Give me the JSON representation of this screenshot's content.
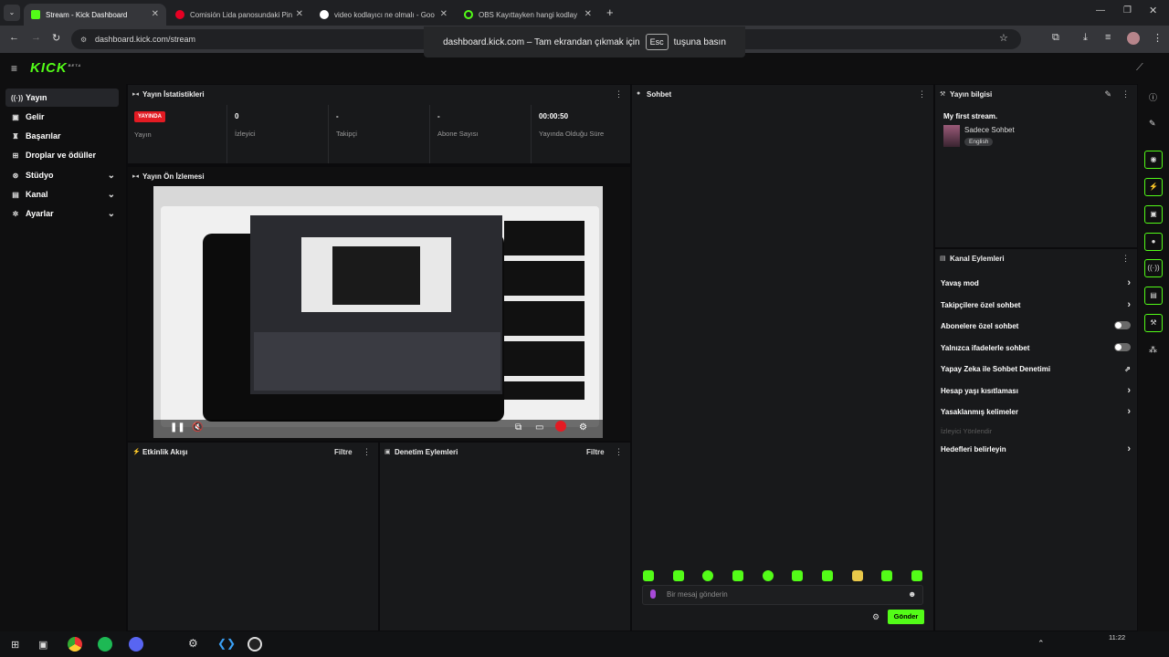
{
  "tabs": [
    {
      "title": "Stream - Kick Dashboard",
      "active": true,
      "fav": "#53fc18"
    },
    {
      "title": "Comisión Lida panosundaki Pin",
      "active": false,
      "fav": "#e60023"
    },
    {
      "title": "video kodlayıcı ne olmalı - Goo",
      "active": false,
      "fav": "#ffffff"
    },
    {
      "title": "OBS Kayıttayken hangi kodlay",
      "active": false,
      "fav": "#53fc18"
    }
  ],
  "address": "dashboard.kick.com/stream",
  "fullscreen_note": {
    "before": "dashboard.kick.com – Tam ekrandan çıkmak için",
    "key": "Esc",
    "after": "tuşuna basın"
  },
  "logo": "KICK",
  "logo_badge": "BETA",
  "sidebar": {
    "items": [
      {
        "label": "Yayın",
        "icon": "broadcast-icon"
      },
      {
        "label": "Gelir",
        "icon": "wallet-icon"
      },
      {
        "label": "Başarılar",
        "icon": "trophy-icon"
      },
      {
        "label": "Droplar ve ödüller",
        "icon": "gift-icon"
      },
      {
        "label": "Stüdyo",
        "icon": "studio-icon"
      },
      {
        "label": "Kanal",
        "icon": "channel-icon"
      },
      {
        "label": "Ayarlar",
        "icon": "gear-icon"
      }
    ]
  },
  "stats_panel": {
    "title": "Yayın İstatistikleri",
    "live_badge": "YAYINDA",
    "stream_label": "Yayın",
    "viewers": {
      "value": "0",
      "label": "İzleyici"
    },
    "followers": {
      "value": "-",
      "label": "Takipçi"
    },
    "subs": {
      "value": "-",
      "label": "Abone Sayısı"
    },
    "duration": {
      "value": "00:00:50",
      "label": "Yayında Olduğu Süre"
    }
  },
  "preview_panel": {
    "title": "Yayın Ön İzlemesi"
  },
  "activity_panel": {
    "title": "Etkinlik Akışı",
    "filter": "Filtre"
  },
  "moderation_panel": {
    "title": "Denetim Eylemleri",
    "filter": "Filtre"
  },
  "chat_panel": {
    "title": "Sohbet",
    "placeholder": "Bir mesaj gönderin",
    "send": "Gönder"
  },
  "info_panel": {
    "title": "Yayın bilgisi",
    "stream_title": "My first stream.",
    "category": "Sadece Sohbet",
    "language": "English"
  },
  "channel_actions": {
    "title": "Kanal Eylemleri",
    "items": [
      {
        "label": "Yavaş mod",
        "control": "arrow"
      },
      {
        "label": "Takipçilere özel sohbet",
        "control": "arrow"
      },
      {
        "label": "Abonelere özel sohbet",
        "control": "toggle"
      },
      {
        "label": "Yalnızca ifadelerle sohbet",
        "control": "toggle"
      },
      {
        "label": "Yapay Zeka ile Sohbet Denetimi",
        "control": "external"
      },
      {
        "label": "Hesap yaşı kısıtlaması",
        "control": "arrow"
      },
      {
        "label": "Yasaklanmış kelimeler",
        "control": "arrow"
      },
      {
        "label": "İzleyici Yönlendir",
        "control": "disabled"
      },
      {
        "label": "Hedefleri belirleyin",
        "control": "arrow"
      }
    ]
  },
  "clock": "11:22",
  "colors": {
    "accent": "#53fc18",
    "live": "#e31b23"
  }
}
